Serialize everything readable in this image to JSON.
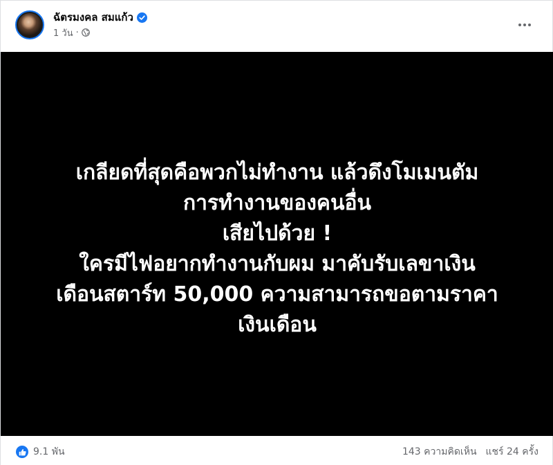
{
  "post": {
    "author": {
      "name": "ฉัตรมงคล สมแก้ว",
      "verified": true
    },
    "time": "1 วัน",
    "dot": "·",
    "privacy_icon": "globe-icon",
    "image_text": {
      "lines": [
        "เกลียดที่สุดคือพวกไม่ทำงาน แล้วดึงโมเมนตัม",
        "การทำงานของคนอื่น",
        "เสียไปด้วย !",
        "ใครมีไฟอยากทำงานกับผม มาคับรับเลขาเงิน",
        "เดือนสตาร์ท 50,000 ความสามารถขอตามราคา",
        "เงินเดือน"
      ]
    },
    "reactions": {
      "icon": "like-icon",
      "count": "9.1 พัน"
    },
    "comments": "143 ความคิดเห็น",
    "shares": "แชร์ 24 ครั้ง"
  },
  "colors": {
    "accent": "#1877f2",
    "secondary_text": "#65676b",
    "image_background": "#000000"
  }
}
